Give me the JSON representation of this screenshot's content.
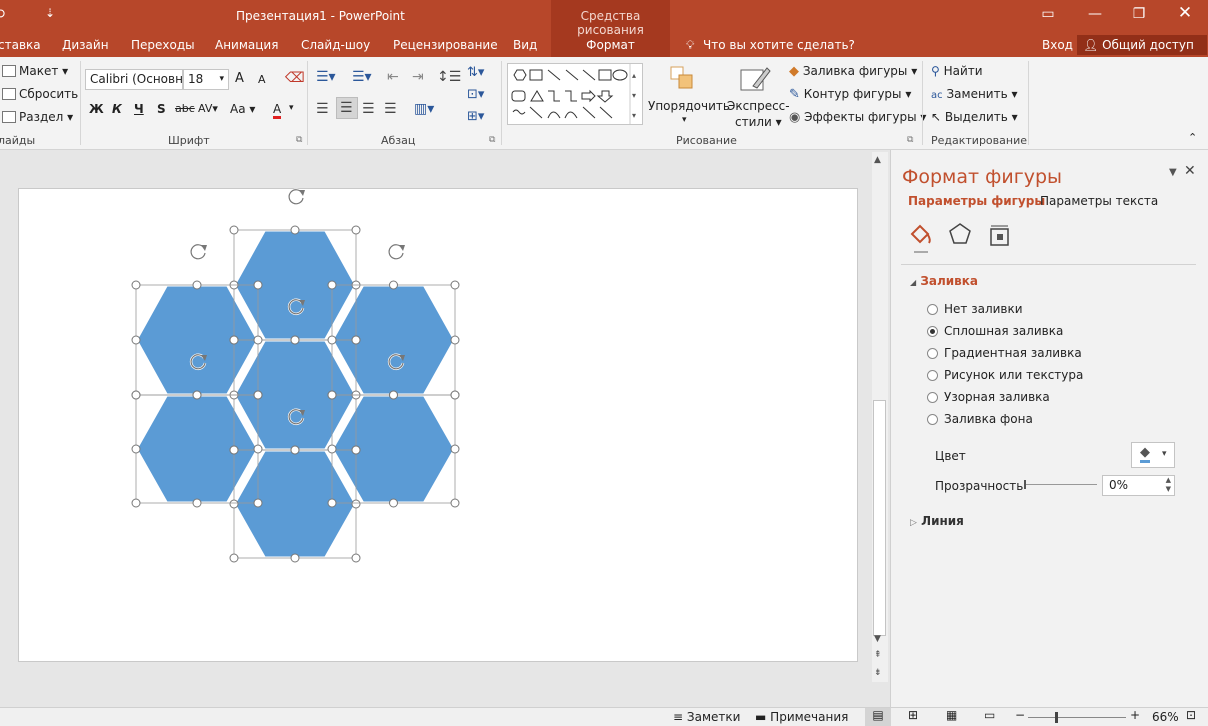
{
  "titlebar": {
    "title": "Презентация1 - PowerPoint",
    "context_group": "Средства рисования",
    "qat_arrow": "⇣"
  },
  "tabs": {
    "items": [
      "ставка",
      "Дизайн",
      "Переходы",
      "Анимация",
      "Слайд-шоу",
      "Рецензирование",
      "Вид"
    ],
    "active": "Формат",
    "tell_me": "Что вы хотите сделать?",
    "signin": "Вход",
    "share": "Общий доступ"
  },
  "ribbon": {
    "slides_group": {
      "layout": "Макет",
      "reset": "Сбросить",
      "section": "Раздел",
      "label": "лайды"
    },
    "font_group": {
      "font_name": "Calibri (Основн",
      "font_size": "18",
      "bold": "Ж",
      "italic": "К",
      "underline": "Ч",
      "shadow": "S",
      "strike": "abc",
      "spacing": "AV",
      "case": "Aa",
      "color": "A",
      "grow": "A",
      "shrink": "A",
      "label": "Шрифт"
    },
    "paragraph_group": {
      "label": "Абзац"
    },
    "drawing_group": {
      "arrange": "Упорядочить",
      "quick_styles_1": "Экспресс-",
      "quick_styles_2": "стили",
      "fill": "Заливка фигуры",
      "outline": "Контур фигуры",
      "effects": "Эффекты фигуры",
      "label": "Рисование"
    },
    "editing_group": {
      "find": "Найти",
      "replace": "Заменить",
      "select": "Выделить",
      "label": "Редактирование"
    }
  },
  "pane": {
    "title": "Формат фигуры",
    "tab_shape": "Параметры фигуры",
    "tab_text": "Параметры текста",
    "section_fill": "Заливка",
    "fill_options": [
      "Нет заливки",
      "Сплошная заливка",
      "Градиентная заливка",
      "Рисунок или текстура",
      "Узорная заливка",
      "Заливка фона"
    ],
    "selected_fill": 1,
    "color_label": "Цвет",
    "transparency_label": "Прозрачность",
    "transparency_value": "0%",
    "section_line": "Линия"
  },
  "status": {
    "notes": "Заметки",
    "comments": "Примечания",
    "zoom": "66%"
  },
  "colors": {
    "accent": "#b7472a",
    "hex_fill": "#5b9bd5"
  }
}
